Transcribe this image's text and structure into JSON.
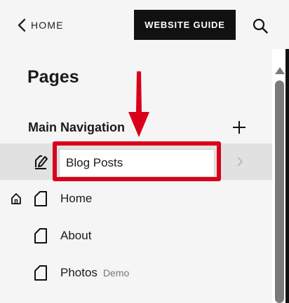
{
  "topbar": {
    "back_label": "HOME",
    "guide_label": "WEBSITE GUIDE"
  },
  "panel": {
    "title": "Pages",
    "section_label": "Main Navigation"
  },
  "pages": [
    {
      "label": "Blog Posts",
      "selected": true,
      "editing": true
    },
    {
      "label": "Home",
      "is_homepage": true
    },
    {
      "label": "About"
    },
    {
      "label": "Photos",
      "tag": "Demo"
    }
  ],
  "colors": {
    "accent": "#d9001b",
    "button_bg": "#111111",
    "panel_bg": "#f5f5f5",
    "selected_row_bg": "#e1e1e1"
  },
  "icons": [
    "chevron-left-icon",
    "search-icon",
    "plus-icon",
    "edit-page-icon",
    "home-icon",
    "page-icon",
    "chevron-right-icon"
  ]
}
